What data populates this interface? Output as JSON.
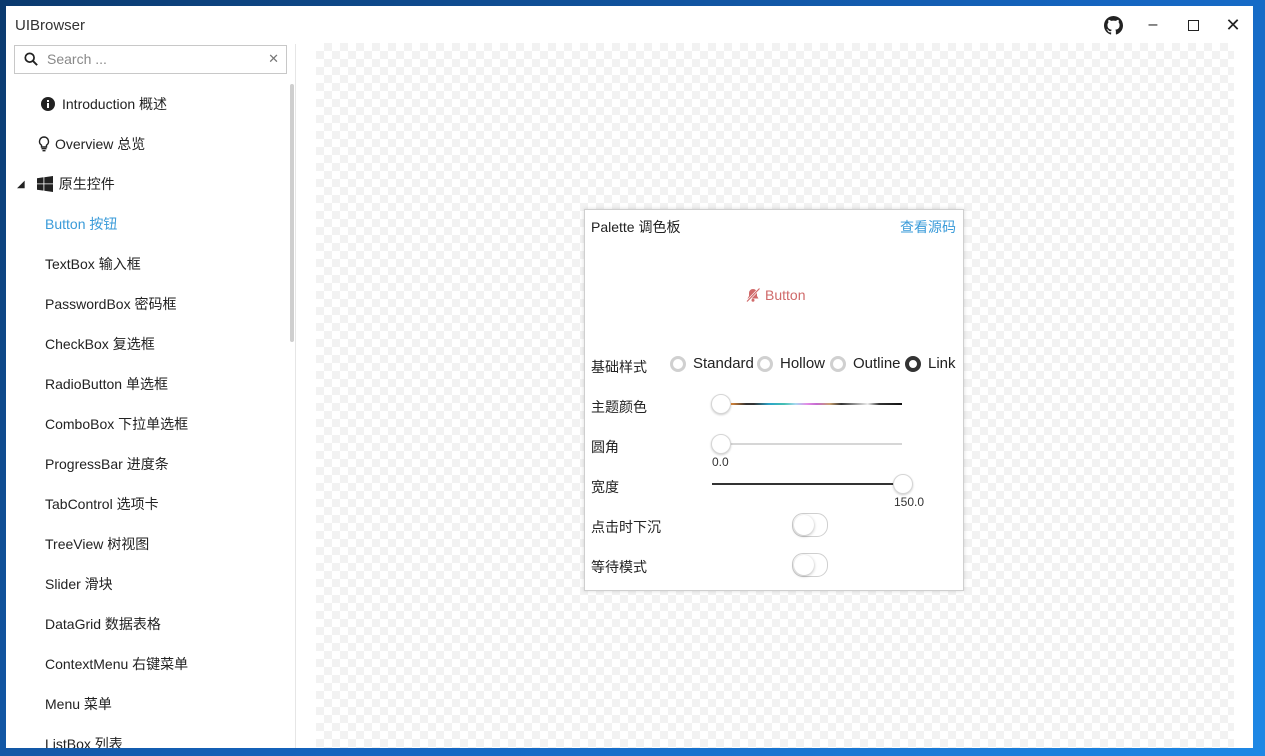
{
  "window": {
    "title": "UIBrowser"
  },
  "search": {
    "placeholder": "Search ..."
  },
  "sidebar": {
    "top_items": [
      {
        "label": "Introduction 概述",
        "icon": "info-icon"
      },
      {
        "label": "Overview 总览",
        "icon": "lightbulb-icon"
      }
    ],
    "group": {
      "label": "原生控件",
      "icon": "windows-icon",
      "expanded": true
    },
    "items": [
      "Button 按钮",
      "TextBox 输入框",
      "PasswordBox 密码框",
      "CheckBox 复选框",
      "RadioButton 单选框",
      "ComboBox 下拉单选框",
      "ProgressBar 进度条",
      "TabControl 选项卡",
      "TreeView 树视图",
      "Slider 滑块",
      "DataGrid 数据表格",
      "ContextMenu 右键菜单",
      "Menu 菜单",
      "ListBox 列表"
    ],
    "selected_index": 0
  },
  "card": {
    "title": "Palette 调色板",
    "source_link": "查看源码",
    "preview_button": {
      "label": "Button",
      "icon": "bell-off-icon",
      "color": "#d06a6a"
    },
    "style_label": "基础样式",
    "styles": [
      "Standard",
      "Hollow",
      "Outline",
      "Link"
    ],
    "selected_style": "Link",
    "theme_color_label": "主题颜色",
    "theme_color_value": 0,
    "corner_label": "圆角",
    "corner_value": "0.0",
    "width_label": "宽度",
    "width_value": "150.0",
    "width_fraction": 1.0,
    "sink_label": "点击时下沉",
    "sink_on": false,
    "wait_label": "等待模式",
    "wait_on": false
  },
  "colors": {
    "accent": "#3a9bd9",
    "link": "#3a9bd9",
    "preview": "#d06a6a"
  }
}
